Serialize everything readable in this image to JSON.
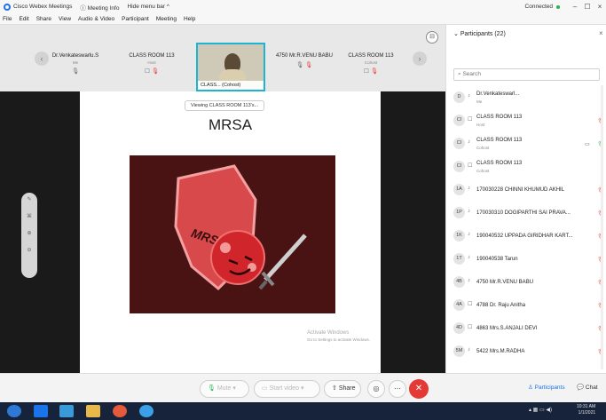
{
  "titlebar": {
    "app_name": "Cisco Webex Meetings",
    "meeting_info": "Meeting Info",
    "hide_menu": "Hide menu bar",
    "status": "Connected",
    "minimize": "–",
    "restore": "☐",
    "close": "×"
  },
  "menu": [
    "File",
    "Edit",
    "Share",
    "View",
    "Audio & Video",
    "Participant",
    "Meeting",
    "Help"
  ],
  "strip": {
    "prev": "‹",
    "next": "›",
    "tiles": [
      {
        "name": "Dr.Venkateswarlu.S",
        "role": "Me"
      },
      {
        "name": "CLASS ROOM 113",
        "role": "Host"
      },
      {
        "name": "4750 Mr.R.VENU BABU",
        "role": ""
      },
      {
        "name": "CLASS ROOM 113",
        "role": "Cohost"
      }
    ],
    "active_label": "CLASS... (Cohost)",
    "layout_icon": "⊟"
  },
  "stage": {
    "viewing": "Viewing CLASS ROOM 113's...",
    "slide_title": "MRSA",
    "shield_text": "MRSA",
    "watermark_title": "Activate Windows",
    "watermark_sub": "Go to Settings to activate Windows."
  },
  "controls": {
    "mute": "Mute",
    "start_video": "Start video",
    "share": "Share",
    "participants": "Participants",
    "chat": "Chat"
  },
  "panel": {
    "header": "Participants (22)",
    "close": "×",
    "search_placeholder": "Search",
    "participants": [
      {
        "initials": "D",
        "name": "Dr.Venkateswarl...",
        "role": "Me",
        "mic": ""
      },
      {
        "initials": "CI",
        "name": "CLASS ROOM 113",
        "role": "Host",
        "mic": "🎙"
      },
      {
        "initials": "CI",
        "name": "CLASS ROOM 113",
        "role": "Cohost",
        "mic": "🎙"
      },
      {
        "initials": "CI",
        "name": "CLASS ROOM 113",
        "role": "Cohost",
        "mic": ""
      },
      {
        "initials": "1A",
        "name": "170030228 CHINNI KHUMUD AKHIL",
        "role": "",
        "mic": "🎙"
      },
      {
        "initials": "1P",
        "name": "170030310 DOGIPARTHI SAI PRAVA...",
        "role": "",
        "mic": "🎙"
      },
      {
        "initials": "1K",
        "name": "190040532 UPPADA GIRIDHAR KART...",
        "role": "",
        "mic": "🎙"
      },
      {
        "initials": "1T",
        "name": "190040538 Tarun",
        "role": "",
        "mic": "🎙"
      },
      {
        "initials": "4B",
        "name": "4750 Mr.R.VENU BABU",
        "role": "",
        "mic": "🎙"
      },
      {
        "initials": "4A",
        "name": "4788 Dr. Raju Anitha",
        "role": "",
        "mic": "🎙"
      },
      {
        "initials": "4D",
        "name": "4863 Mrs.S.ANJALI DEVI",
        "role": "",
        "mic": "🎙"
      },
      {
        "initials": "5M",
        "name": "5422 Mrs.M.RADHA",
        "role": "",
        "mic": "🎙"
      }
    ]
  },
  "taskbar": {
    "time": "10:31 AM",
    "date": "1/1/2021"
  },
  "colors": {
    "accent": "#1a73e8",
    "end_call": "#e53935",
    "mic_muted": "#e53935",
    "slide_bg": "#4a1313",
    "shield": "#d8494c"
  }
}
